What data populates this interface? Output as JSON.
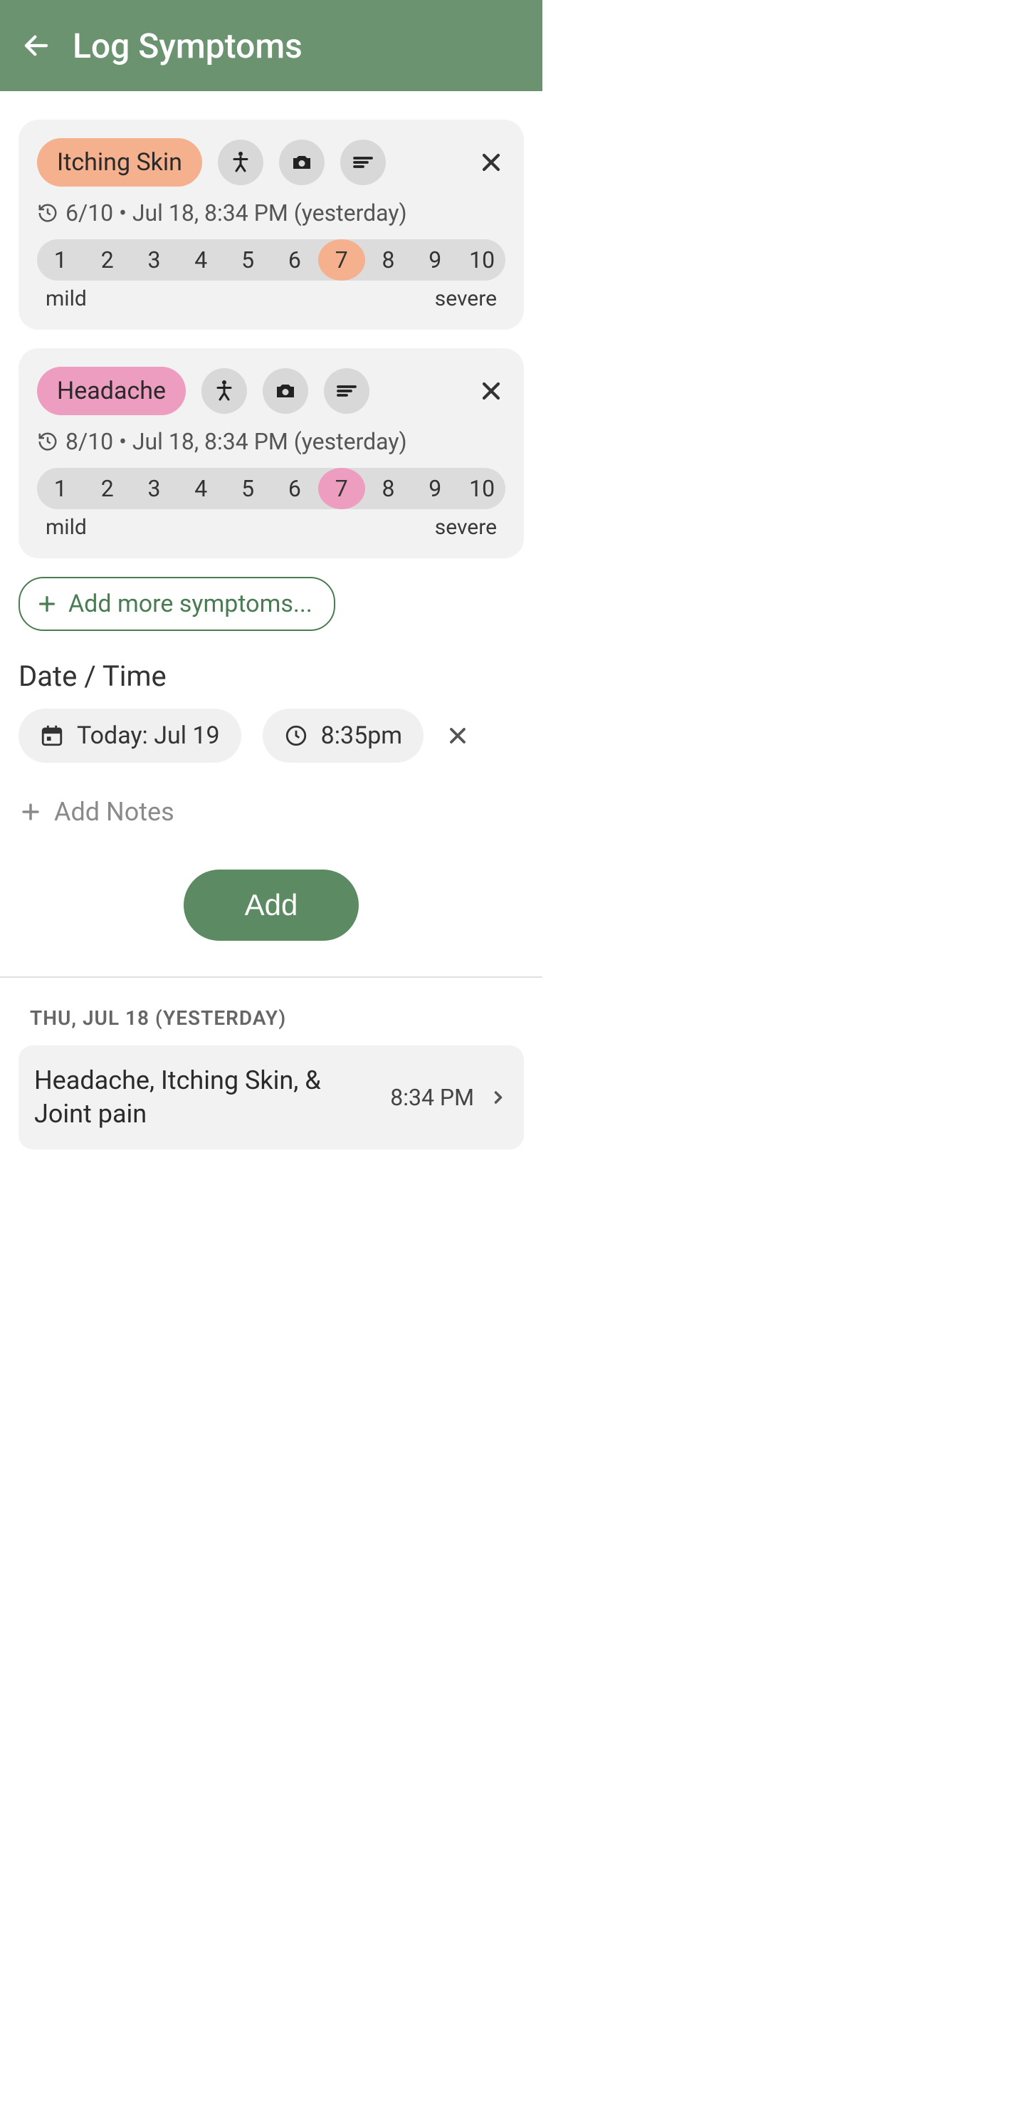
{
  "header": {
    "title": "Log Symptoms"
  },
  "symptoms": [
    {
      "name": "Itching Skin",
      "colorClass": "pill-orange",
      "selClass": "sel-orange",
      "history": "6/10 • Jul 18, 8:34 PM (yesterday)",
      "selected": 7
    },
    {
      "name": "Headache",
      "colorClass": "pill-pink",
      "selClass": "sel-pink",
      "history": "8/10 • Jul 18, 8:34 PM (yesterday)",
      "selected": 7
    }
  ],
  "severity": {
    "scale": [
      1,
      2,
      3,
      4,
      5,
      6,
      7,
      8,
      9,
      10
    ],
    "lowLabel": "mild",
    "highLabel": "severe"
  },
  "addMore": "Add more symptoms...",
  "dateTimeLabel": "Date / Time",
  "dateChip": "Today: Jul 19",
  "timeChip": "8:35pm",
  "addNotes": "Add Notes",
  "addButton": "Add",
  "pastHeader": "THU, JUL 18 (YESTERDAY)",
  "pastItem": {
    "text": "Headache, Itching Skin, & Joint pain",
    "time": "8:34 PM"
  }
}
